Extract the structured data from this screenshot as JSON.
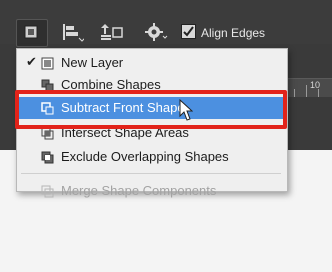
{
  "toolbar": {
    "tools": [
      {
        "name": "path-operations-icon"
      },
      {
        "name": "path-alignment-icon"
      },
      {
        "name": "path-arrangement-icon"
      },
      {
        "name": "gear-icon"
      }
    ],
    "align_edges_label": "Align Edges",
    "align_edges_checked": true
  },
  "ruler": {
    "label": "10"
  },
  "menu": {
    "items": [
      {
        "label": "New Layer",
        "checked": true,
        "state": "normal",
        "icon": "new-layer-icon"
      },
      {
        "label": "Combine Shapes",
        "checked": false,
        "state": "normal",
        "icon": "combine-shapes-icon"
      },
      {
        "label": "Subtract Front Shape",
        "checked": false,
        "state": "highlighted",
        "icon": "subtract-front-shape-icon"
      },
      {
        "label": "Intersect Shape Areas",
        "checked": false,
        "state": "normal",
        "icon": "intersect-shape-areas-icon"
      },
      {
        "label": "Exclude Overlapping Shapes",
        "checked": false,
        "state": "normal",
        "icon": "exclude-overlapping-shapes-icon"
      },
      {
        "label": "Merge Shape Components",
        "checked": false,
        "state": "disabled",
        "icon": "merge-shape-components-icon"
      }
    ]
  },
  "colors": {
    "highlight": "#4c90e0",
    "annotation": "#e2231a",
    "workspace": "#3a3a3a"
  }
}
